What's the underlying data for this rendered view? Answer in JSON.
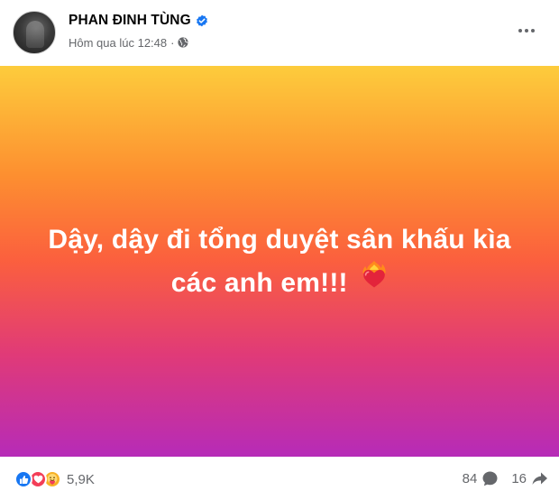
{
  "post": {
    "author": "PHAN ĐINH TÙNG",
    "timestamp": "Hôm qua lúc 12:48",
    "separator": "·",
    "privacy_icon": "globe-icon",
    "verified_icon": "verified-badge-icon",
    "menu_icon": "more-options-icon",
    "message_text": "Dậy, dậy đi tổng duyệt sân khấu kìa các anh em!!!",
    "message_emoji_icon": "heart-on-fire-icon",
    "background_gradient": [
      "#fdcc3c",
      "#fd8f30",
      "#fb5f3e",
      "#e03a78",
      "#b62bb8"
    ]
  },
  "footer": {
    "reaction_icons": [
      "like-icon",
      "love-icon",
      "care-icon"
    ],
    "reaction_count": "5,9K",
    "comment_count": "84",
    "share_count": "16"
  },
  "colors": {
    "link_blue": "#1877f2",
    "secondary_text": "#65676b",
    "love_red": "#f33e58",
    "care_yellow": "#f7b125"
  }
}
